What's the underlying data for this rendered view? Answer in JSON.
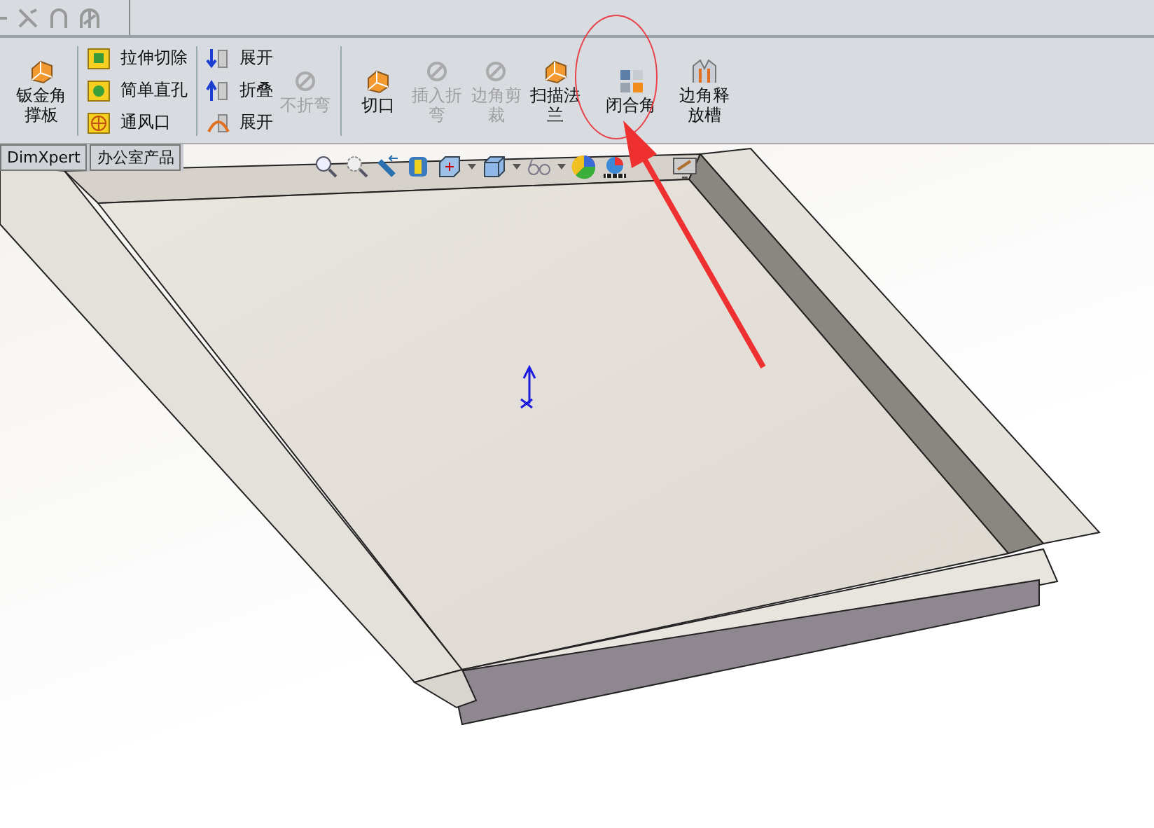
{
  "ribbon": {
    "items": [
      {
        "kind": "large",
        "label": "钣金角撑板",
        "disabled": false
      },
      {
        "kind": "column",
        "rows": [
          {
            "label": "拉伸切除",
            "disabled": false
          },
          {
            "label": "简单直孔",
            "disabled": false
          },
          {
            "label": "通风口",
            "disabled": false
          }
        ]
      },
      {
        "kind": "column",
        "rows": [
          {
            "label": "展开",
            "disabled": false
          },
          {
            "label": "折叠",
            "disabled": false
          },
          {
            "label": "展开",
            "disabled": false
          }
        ]
      },
      {
        "kind": "large",
        "label": "不折弯",
        "disabled": true
      },
      {
        "kind": "large",
        "label": "切口",
        "disabled": false
      },
      {
        "kind": "large",
        "label": "插入折弯",
        "disabled": true
      },
      {
        "kind": "large",
        "label": "边角剪裁",
        "disabled": true
      },
      {
        "kind": "large",
        "label": "扫描法兰",
        "disabled": false
      },
      {
        "kind": "large",
        "label": "闭合角",
        "disabled": false
      },
      {
        "kind": "large",
        "label": "边角释放槽",
        "disabled": false
      }
    ]
  },
  "tabs": [
    {
      "label": "DimXpert",
      "selected": false
    },
    {
      "label": "办公室产品",
      "selected": false
    }
  ]
}
